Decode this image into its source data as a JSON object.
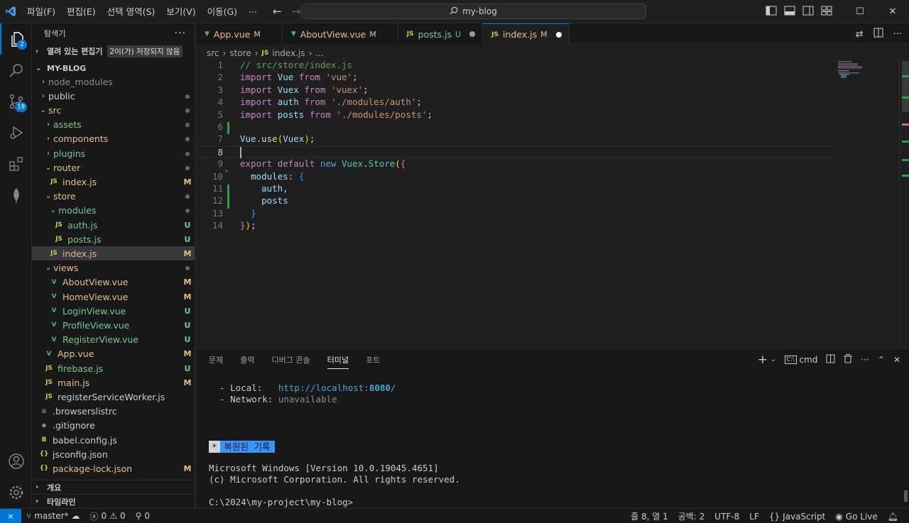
{
  "titlebar": {
    "menu": [
      "파일(F)",
      "편집(E)",
      "선택 영역(S)",
      "보기(V)",
      "이동(G)",
      "···"
    ],
    "search": "my-blog"
  },
  "activity": {
    "explorer_badge": "2",
    "scm_badge": "19"
  },
  "sidebar": {
    "header": "탐색기",
    "open_editors": "열려 있는 편집기",
    "unsaved": "2이(가) 저장되지 않음",
    "project": "MY-BLOG",
    "outline": "개요",
    "timeline": "타임라인"
  },
  "tree": [
    {
      "label": "node_modules",
      "chev": "›",
      "indent": 1,
      "cls": "c-ign",
      "status": ""
    },
    {
      "label": "public",
      "chev": "›",
      "indent": 1,
      "cls": "",
      "status": "dot"
    },
    {
      "label": "src",
      "chev": "⌄",
      "indent": 1,
      "cls": "c-mod",
      "status": "dot"
    },
    {
      "label": "assets",
      "chev": "›",
      "indent": 2,
      "cls": "c-untr",
      "status": "dotg"
    },
    {
      "label": "components",
      "chev": "›",
      "indent": 2,
      "cls": "c-mod",
      "status": "dot"
    },
    {
      "label": "plugins",
      "chev": "›",
      "indent": 2,
      "cls": "c-untr",
      "status": "dotg"
    },
    {
      "label": "router",
      "chev": "⌄",
      "indent": 2,
      "cls": "c-mod",
      "status": "dot"
    },
    {
      "label": "index.js",
      "icon": "JS",
      "indent": 3,
      "cls": "c-mod",
      "status": "M"
    },
    {
      "label": "store",
      "chev": "⌄",
      "indent": 2,
      "cls": "c-mod",
      "status": "dot"
    },
    {
      "label": "modules",
      "chev": "⌄",
      "indent": 3,
      "cls": "c-untr",
      "status": "dotg"
    },
    {
      "label": "auth.js",
      "icon": "JS",
      "indent": 4,
      "cls": "c-untr",
      "status": "U"
    },
    {
      "label": "posts.js",
      "icon": "JS",
      "indent": 4,
      "cls": "c-untr",
      "status": "U"
    },
    {
      "label": "index.js",
      "icon": "JS",
      "indent": 3,
      "cls": "c-mod",
      "status": "M",
      "selected": true
    },
    {
      "label": "views",
      "chev": "⌄",
      "indent": 2,
      "cls": "c-mod",
      "status": "dot"
    },
    {
      "label": "AboutView.vue",
      "icon": "V",
      "indent": 3,
      "cls": "c-mod",
      "status": "M"
    },
    {
      "label": "HomeView.vue",
      "icon": "V",
      "indent": 3,
      "cls": "c-mod",
      "status": "M"
    },
    {
      "label": "LoginView.vue",
      "icon": "V",
      "indent": 3,
      "cls": "c-untr",
      "status": "U"
    },
    {
      "label": "ProfileView.vue",
      "icon": "V",
      "indent": 3,
      "cls": "c-untr",
      "status": "U"
    },
    {
      "label": "RegisterView.vue",
      "icon": "V",
      "indent": 3,
      "cls": "c-untr",
      "status": "U"
    },
    {
      "label": "App.vue",
      "icon": "V",
      "indent": 2,
      "cls": "c-mod",
      "status": "M"
    },
    {
      "label": "firebase.js",
      "icon": "JS",
      "indent": 2,
      "cls": "c-untr",
      "status": "U"
    },
    {
      "label": "main.js",
      "icon": "JS",
      "indent": 2,
      "cls": "c-mod",
      "status": "M"
    },
    {
      "label": "registerServiceWorker.js",
      "icon": "JS",
      "indent": 2,
      "cls": "",
      "status": ""
    },
    {
      "label": ".browserslistrc",
      "icon": "≡",
      "indent": 1,
      "cls": "",
      "status": ""
    },
    {
      "label": ".gitignore",
      "icon": "◆",
      "indent": 1,
      "cls": "",
      "status": ""
    },
    {
      "label": "babel.config.js",
      "icon": "B",
      "indent": 1,
      "cls": "",
      "status": ""
    },
    {
      "label": "jsconfig.json",
      "icon": "{}",
      "indent": 1,
      "cls": "",
      "status": ""
    },
    {
      "label": "package-lock.json",
      "icon": "{}",
      "indent": 1,
      "cls": "c-mod",
      "status": "M"
    }
  ],
  "tabs": [
    {
      "label": "App.vue",
      "icon": "V",
      "status": "M",
      "kind": "m"
    },
    {
      "label": "AboutView.vue",
      "icon": "V",
      "status": "M",
      "kind": "m"
    },
    {
      "label": "posts.js",
      "icon": "JS",
      "status": "U",
      "kind": "u",
      "dot": true
    },
    {
      "label": "index.js",
      "icon": "JS",
      "status": "M",
      "kind": "m",
      "dot": true,
      "active": true
    }
  ],
  "breadcrumb": [
    "src",
    "store",
    "index.js",
    "..."
  ],
  "code_lines": [
    "1",
    "2",
    "3",
    "4",
    "5",
    "6",
    "7",
    "8",
    "9",
    "10",
    "11",
    "12",
    "13",
    "14"
  ],
  "code_text": {
    "l1": "// src/store/index.js",
    "l2a": "import",
    "l2b": "Vue",
    "l2c": "from",
    "l2d": "'vue'",
    "l3a": "import",
    "l3b": "Vuex",
    "l3c": "from",
    "l3d": "'vuex'",
    "l4a": "import",
    "l4b": "auth",
    "l4c": "from",
    "l4d": "'./modules/auth'",
    "l5a": "import",
    "l5b": "posts",
    "l5c": "from",
    "l5d": "'./modules/posts'",
    "l7a": "Vue",
    "l7b": "use",
    "l7c": "Vuex",
    "l9a": "export",
    "l9b": "default",
    "l9c": "new",
    "l9d": "Vuex",
    "l9e": "Store",
    "l10": "modules",
    "l11": "auth",
    "l12": "posts"
  },
  "panel": {
    "tabs": [
      "문제",
      "출력",
      "디버그 콘솔",
      "터미널",
      "포트"
    ],
    "shell": "cmd",
    "local_label": "- Local:",
    "local_url_a": "http://localhost:",
    "local_url_b": "8080",
    "local_url_c": "/",
    "network_label": "- Network:",
    "network_value": "unavailable",
    "restored_star": "*",
    "restored": "복원된 기록",
    "win_ver": "Microsoft Windows [Version 10.0.19045.4651]",
    "copyright": "(c) Microsoft Corporation. All rights reserved.",
    "prompt": "C:\\2024\\my-project\\my-blog>"
  },
  "statusbar": {
    "branch": "master*",
    "errors": "0",
    "warnings": "0",
    "ports": "0",
    "position": "줄 8, 열 1",
    "spaces": "공백: 2",
    "encoding": "UTF-8",
    "eol": "LF",
    "language": "JavaScript",
    "golive": "Go Live"
  },
  "colors": {
    "accent": "#0078d4",
    "modified": "#e2c08d",
    "untracked": "#73c991"
  }
}
